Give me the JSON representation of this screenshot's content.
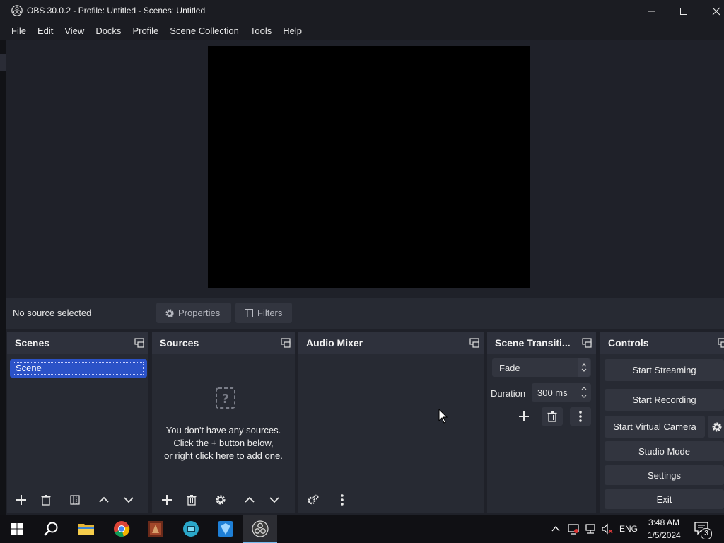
{
  "window": {
    "title": "OBS 30.0.2 - Profile: Untitled - Scenes: Untitled"
  },
  "menu": [
    "File",
    "Edit",
    "View",
    "Docks",
    "Profile",
    "Scene Collection",
    "Tools",
    "Help"
  ],
  "source_bar": {
    "status": "No source selected",
    "properties_label": "Properties",
    "filters_label": "Filters"
  },
  "docks": {
    "scenes": {
      "title": "Scenes",
      "items": [
        "Scene"
      ]
    },
    "sources": {
      "title": "Sources",
      "empty_line1": "You don't have any sources.",
      "empty_line2": "Click the + button below,",
      "empty_line3": "or right click here to add one."
    },
    "audio": {
      "title": "Audio Mixer"
    },
    "transitions": {
      "title": "Scene Transiti...",
      "selected": "Fade",
      "duration_label": "Duration",
      "duration_value": "300 ms"
    },
    "controls": {
      "title": "Controls",
      "start_streaming": "Start Streaming",
      "start_recording": "Start Recording",
      "start_virtual_camera": "Start Virtual Camera",
      "studio_mode": "Studio Mode",
      "settings": "Settings",
      "exit": "Exit"
    }
  },
  "taskbar": {
    "language": "ENG",
    "time": "3:48 AM",
    "date": "1/5/2024",
    "notifications": "3"
  },
  "colors": {
    "accent_selection": "#2b52c7",
    "dock_background": "#272a33",
    "preview_background": "#000000"
  }
}
